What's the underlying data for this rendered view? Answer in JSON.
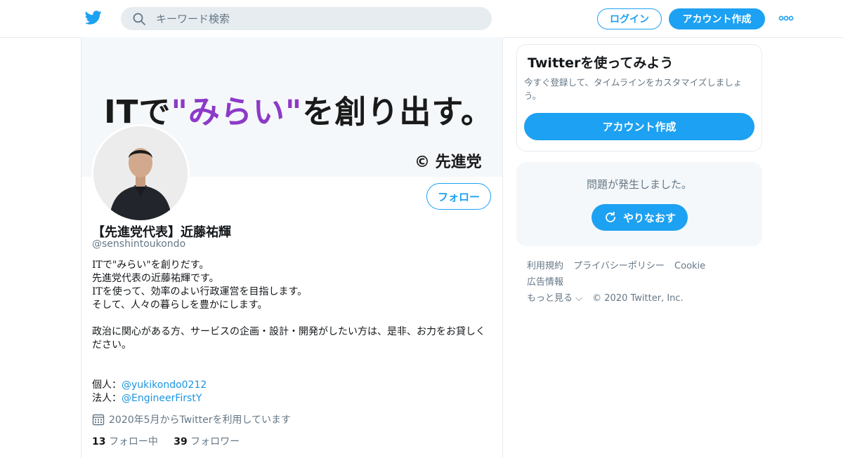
{
  "header": {
    "logo": "twitter-bird-icon",
    "search_placeholder": "キーワード検索",
    "login_label": "ログイン",
    "signup_label": "アカウント作成",
    "more_icon": "more-dots-icon"
  },
  "banner": {
    "text_before": "ITで",
    "text_highlight": "\"みらい\"",
    "text_after": "を創り出す。",
    "credit": "© 先進党",
    "highlight_color": "#8c3ac8"
  },
  "profile": {
    "follow_label": "フォロー",
    "name": "【先進党代表】近藤祐輝",
    "handle": "@senshintoukondo",
    "bio_lines": [
      "ITで\"みらい\"を創りだす。",
      "先進党代表の近藤祐輝です。",
      "ITを使って、効率のよい行政運営を目指します。",
      "そして、人々の暮らしを豊かにします。",
      "",
      "政治に関心がある方、サービスの企画・設計・開発がしたい方は、是非、お力をお貸しください。",
      "",
      ""
    ],
    "personal_label": "個人：",
    "personal_link": "@yukikondo0212",
    "corporate_label": "法人：",
    "corporate_link": "@EngineerFirstY",
    "joined": "2020年5月からTwitterを利用しています",
    "following_count": "13",
    "following_label": "フォロー中",
    "followers_count": "39",
    "followers_label": "フォロワー"
  },
  "sidebar": {
    "card_title": "Twitterを使ってみよう",
    "card_subtitle": "今すぐ登録して、タイムラインをカスタマイズしましょう。",
    "card_button": "アカウント作成",
    "error_text": "問題が発生しました。",
    "retry_label": "やりなおす"
  },
  "footer": {
    "links": [
      "利用規約",
      "プライバシーポリシー",
      "Cookie",
      "広告情報"
    ],
    "more_label": "もっと見る ⌵",
    "copyright": "© 2020 Twitter, Inc."
  },
  "colors": {
    "accent": "#1da1f2",
    "muted": "#657786",
    "link": "#1b95e0"
  }
}
